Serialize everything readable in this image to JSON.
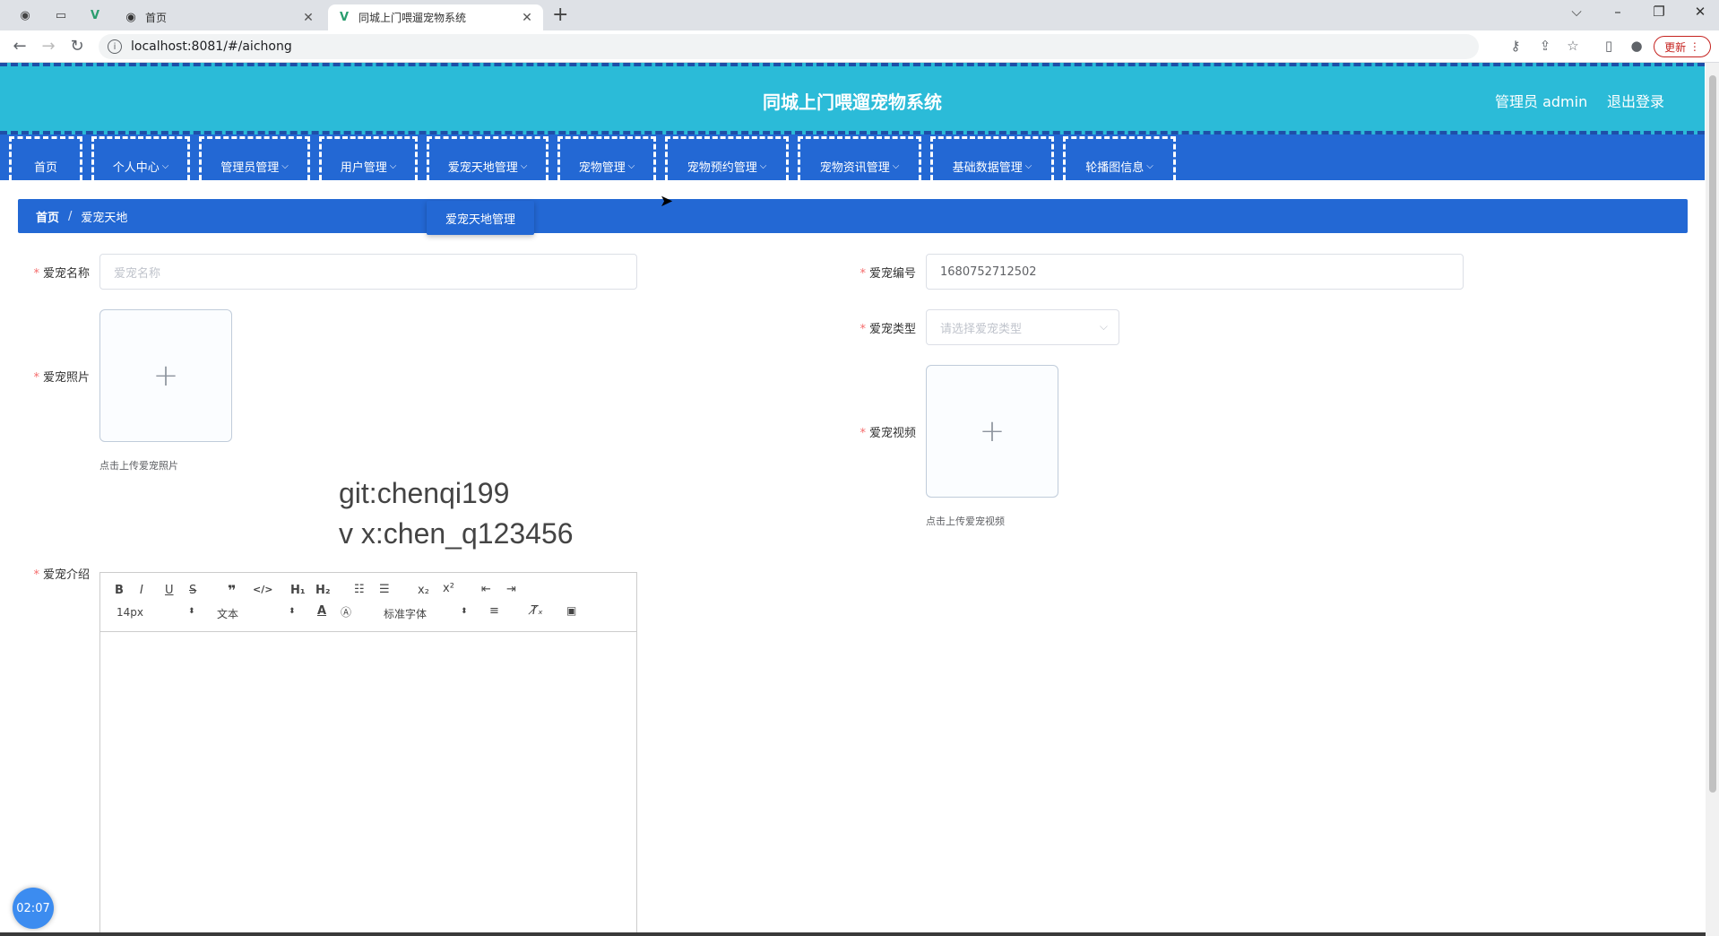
{
  "browser": {
    "tabs": [
      {
        "title": "首页",
        "active": false
      },
      {
        "title": "同城上门喂遛宠物系统",
        "active": true
      }
    ],
    "url": "localhost:8081/#/aichong",
    "update_label": "更新"
  },
  "header": {
    "title": "同城上门喂遛宠物系统",
    "user": "管理员 admin",
    "logout": "退出登录"
  },
  "nav": {
    "items": [
      {
        "label": "首页",
        "chev": ""
      },
      {
        "label": "个人中心",
        "chev": "⌵"
      },
      {
        "label": "管理员管理",
        "chev": "⌵"
      },
      {
        "label": "用户管理",
        "chev": "⌵"
      },
      {
        "label": "爱宠天地管理",
        "chev": "⌵"
      },
      {
        "label": "宠物管理",
        "chev": "⌵"
      },
      {
        "label": "宠物预约管理",
        "chev": "⌵"
      },
      {
        "label": "宠物资讯管理",
        "chev": "⌵"
      },
      {
        "label": "基础数据管理",
        "chev": "⌵"
      },
      {
        "label": "轮播图信息",
        "chev": "⌵"
      }
    ],
    "dropdown": "爱宠天地管理"
  },
  "breadcrumb": {
    "home": "首页",
    "sep": "/",
    "current": "爱宠天地"
  },
  "form": {
    "name_label": "爱宠名称",
    "name_placeholder": "爱宠名称",
    "code_label": "爱宠编号",
    "code_value": "1680752712502",
    "photo_label": "爱宠照片",
    "photo_tip": "点击上传爱宠照片",
    "type_label": "爱宠类型",
    "type_placeholder": "请选择爱宠类型",
    "video_label": "爱宠视频",
    "video_tip": "点击上传爱宠视频",
    "intro_label": "爱宠介绍",
    "upload_plus": "+"
  },
  "watermark": {
    "line1": "git:chenqi199",
    "line2": "v x:chen_q123456"
  },
  "editor": {
    "size": "14px",
    "header": "文本",
    "font": "标准字体"
  },
  "clock": "02:07"
}
